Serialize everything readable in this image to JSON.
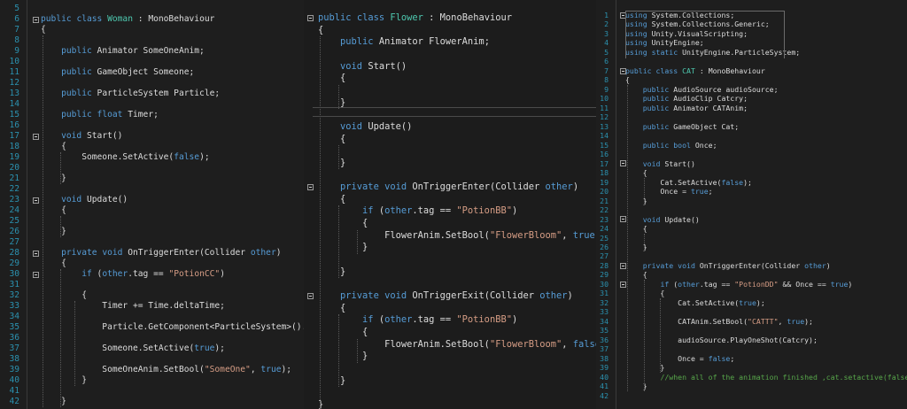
{
  "panels": [
    {
      "id": "woman",
      "line_numbers": [
        "5",
        "6",
        "7",
        "8",
        "9",
        "10",
        "11",
        "12",
        "13",
        "14",
        "15",
        "16",
        "17",
        "18",
        "19",
        "20",
        "21",
        "22",
        "23",
        "24",
        "25",
        "26",
        "27",
        "28",
        "29",
        "30",
        "31",
        "32",
        "33",
        "34",
        "35",
        "36",
        "37",
        "38",
        "39",
        "40",
        "41",
        "42"
      ],
      "lines": [
        [],
        [
          [
            "k",
            "public"
          ],
          [
            "pl",
            " "
          ],
          [
            "k",
            "class"
          ],
          [
            "pl",
            " "
          ],
          [
            "t",
            "Woman"
          ],
          [
            "pl",
            " : MonoBehaviour"
          ]
        ],
        [
          [
            "pl",
            "{"
          ]
        ],
        [],
        [
          [
            "pl",
            "    "
          ],
          [
            "k",
            "public"
          ],
          [
            "pl",
            " Animator SomeOneAnim;"
          ]
        ],
        [],
        [
          [
            "pl",
            "    "
          ],
          [
            "k",
            "public"
          ],
          [
            "pl",
            " GameObject Someone;"
          ]
        ],
        [],
        [
          [
            "pl",
            "    "
          ],
          [
            "k",
            "public"
          ],
          [
            "pl",
            " ParticleSystem Particle;"
          ]
        ],
        [],
        [
          [
            "pl",
            "    "
          ],
          [
            "k",
            "public"
          ],
          [
            "pl",
            " "
          ],
          [
            "k",
            "float"
          ],
          [
            "pl",
            " Timer;"
          ]
        ],
        [],
        [
          [
            "pl",
            "    "
          ],
          [
            "k",
            "void"
          ],
          [
            "pl",
            " Start()"
          ]
        ],
        [
          [
            "pl",
            "    {"
          ]
        ],
        [
          [
            "pl",
            "        Someone.SetActive("
          ],
          [
            "k",
            "false"
          ],
          [
            "pl",
            ");"
          ]
        ],
        [],
        [
          [
            "pl",
            "    }"
          ]
        ],
        [],
        [
          [
            "pl",
            "    "
          ],
          [
            "k",
            "void"
          ],
          [
            "pl",
            " Update()"
          ]
        ],
        [
          [
            "pl",
            "    {"
          ]
        ],
        [],
        [
          [
            "pl",
            "    }"
          ]
        ],
        [],
        [
          [
            "pl",
            "    "
          ],
          [
            "k",
            "private"
          ],
          [
            "pl",
            " "
          ],
          [
            "k",
            "void"
          ],
          [
            "pl",
            " OnTriggerEnter(Collider "
          ],
          [
            "k",
            "other"
          ],
          [
            "pl",
            ")"
          ]
        ],
        [
          [
            "pl",
            "    {"
          ]
        ],
        [
          [
            "pl",
            "        "
          ],
          [
            "k",
            "if"
          ],
          [
            "pl",
            " ("
          ],
          [
            "k",
            "other"
          ],
          [
            "pl",
            ".tag == "
          ],
          [
            "s",
            "\"PotionCC\""
          ],
          [
            "pl",
            ")"
          ]
        ],
        [],
        [
          [
            "pl",
            "        {"
          ]
        ],
        [
          [
            "pl",
            "            Timer += Time.deltaTime;"
          ]
        ],
        [],
        [
          [
            "pl",
            "            Particle.GetComponent<ParticleSystem>().Play();"
          ]
        ],
        [],
        [
          [
            "pl",
            "            Someone.SetActive("
          ],
          [
            "k",
            "true"
          ],
          [
            "pl",
            ");"
          ]
        ],
        [],
        [
          [
            "pl",
            "            SomeOneAnim.SetBool("
          ],
          [
            "s",
            "\"SomeOne\""
          ],
          [
            "pl",
            ", "
          ],
          [
            "k",
            "true"
          ],
          [
            "pl",
            ");"
          ]
        ],
        [
          [
            "pl",
            "        }"
          ]
        ],
        [],
        [
          [
            "pl",
            "    }"
          ]
        ]
      ]
    },
    {
      "id": "flower",
      "line_numbers": [],
      "lines": [
        [
          [
            "k",
            "public"
          ],
          [
            "pl",
            " "
          ],
          [
            "k",
            "class"
          ],
          [
            "pl",
            " "
          ],
          [
            "t",
            "Flower"
          ],
          [
            "pl",
            " : MonoBehaviour"
          ]
        ],
        [
          [
            "pl",
            "{"
          ]
        ],
        [
          [
            "pl",
            "    "
          ],
          [
            "k",
            "public"
          ],
          [
            "pl",
            " Animator FlowerAnim;"
          ]
        ],
        [],
        [
          [
            "pl",
            "    "
          ],
          [
            "k",
            "void"
          ],
          [
            "pl",
            " Start()"
          ]
        ],
        [
          [
            "pl",
            "    {"
          ]
        ],
        [],
        [
          [
            "pl",
            "    }"
          ]
        ],
        [],
        [
          [
            "pl",
            "    "
          ],
          [
            "k",
            "void"
          ],
          [
            "pl",
            " Update()"
          ]
        ],
        [
          [
            "pl",
            "    {"
          ]
        ],
        [],
        [
          [
            "pl",
            "    }"
          ]
        ],
        [],
        [
          [
            "pl",
            "    "
          ],
          [
            "k",
            "private"
          ],
          [
            "pl",
            " "
          ],
          [
            "k",
            "void"
          ],
          [
            "pl",
            " OnTriggerEnter(Collider "
          ],
          [
            "k",
            "other"
          ],
          [
            "pl",
            ")"
          ]
        ],
        [
          [
            "pl",
            "    {"
          ]
        ],
        [
          [
            "pl",
            "        "
          ],
          [
            "k",
            "if"
          ],
          [
            "pl",
            " ("
          ],
          [
            "k",
            "other"
          ],
          [
            "pl",
            ".tag == "
          ],
          [
            "s",
            "\"PotionBB\""
          ],
          [
            "pl",
            ")"
          ]
        ],
        [
          [
            "pl",
            "        {"
          ]
        ],
        [
          [
            "pl",
            "            FlowerAnim.SetBool("
          ],
          [
            "s",
            "\"FlowerBloom\""
          ],
          [
            "pl",
            ", "
          ],
          [
            "k",
            "true"
          ],
          [
            "pl",
            ");"
          ]
        ],
        [
          [
            "pl",
            "        }"
          ]
        ],
        [],
        [
          [
            "pl",
            "    }"
          ]
        ],
        [],
        [
          [
            "pl",
            "    "
          ],
          [
            "k",
            "private"
          ],
          [
            "pl",
            " "
          ],
          [
            "k",
            "void"
          ],
          [
            "pl",
            " OnTriggerExit(Collider "
          ],
          [
            "k",
            "other"
          ],
          [
            "pl",
            ")"
          ]
        ],
        [
          [
            "pl",
            "    {"
          ]
        ],
        [
          [
            "pl",
            "        "
          ],
          [
            "k",
            "if"
          ],
          [
            "pl",
            " ("
          ],
          [
            "k",
            "other"
          ],
          [
            "pl",
            ".tag == "
          ],
          [
            "s",
            "\"PotionBB\""
          ],
          [
            "pl",
            ")"
          ]
        ],
        [
          [
            "pl",
            "        {"
          ]
        ],
        [
          [
            "pl",
            "            FlowerAnim.SetBool("
          ],
          [
            "s",
            "\"FlowerBloom\""
          ],
          [
            "pl",
            ", "
          ],
          [
            "k",
            "false"
          ],
          [
            "pl",
            ");"
          ]
        ],
        [
          [
            "pl",
            "        }"
          ]
        ],
        [],
        [
          [
            "pl",
            "    }"
          ]
        ],
        [],
        [
          [
            "pl",
            "}"
          ]
        ]
      ]
    },
    {
      "id": "cat",
      "line_numbers": [
        "1",
        "2",
        "3",
        "4",
        "5",
        "6",
        "7",
        "8",
        "9",
        "10",
        "11",
        "12",
        "13",
        "14",
        "15",
        "16",
        "17",
        "18",
        "19",
        "20",
        "21",
        "22",
        "23",
        "24",
        "25",
        "26",
        "27",
        "28",
        "29",
        "30",
        "31",
        "32",
        "33",
        "34",
        "35",
        "36",
        "37",
        "38",
        "39",
        "40",
        "41",
        "42"
      ],
      "lines": [
        [
          [
            "k",
            "using"
          ],
          [
            "pl",
            " System.Collections;"
          ]
        ],
        [
          [
            "k",
            "using"
          ],
          [
            "pl",
            " System.Collections.Generic;"
          ]
        ],
        [
          [
            "k",
            "using"
          ],
          [
            "pl",
            " Unity.VisualScripting;"
          ]
        ],
        [
          [
            "k",
            "using"
          ],
          [
            "pl",
            " UnityEngine;"
          ]
        ],
        [
          [
            "k",
            "using"
          ],
          [
            "pl",
            " "
          ],
          [
            "k",
            "static"
          ],
          [
            "pl",
            " UnityEngine.ParticleSystem;"
          ]
        ],
        [],
        [
          [
            "k",
            "public"
          ],
          [
            "pl",
            " "
          ],
          [
            "k",
            "class"
          ],
          [
            "pl",
            " "
          ],
          [
            "t",
            "CAT"
          ],
          [
            "pl",
            " : MonoBehaviour"
          ]
        ],
        [
          [
            "pl",
            "{"
          ]
        ],
        [
          [
            "pl",
            "    "
          ],
          [
            "k",
            "public"
          ],
          [
            "pl",
            " AudioSource audioSource;"
          ]
        ],
        [
          [
            "pl",
            "    "
          ],
          [
            "k",
            "public"
          ],
          [
            "pl",
            " AudioClip Catcry;"
          ]
        ],
        [
          [
            "pl",
            "    "
          ],
          [
            "k",
            "public"
          ],
          [
            "pl",
            " Animator CATAnim;"
          ]
        ],
        [],
        [
          [
            "pl",
            "    "
          ],
          [
            "k",
            "public"
          ],
          [
            "pl",
            " GameObject Cat;"
          ]
        ],
        [],
        [
          [
            "pl",
            "    "
          ],
          [
            "k",
            "public"
          ],
          [
            "pl",
            " "
          ],
          [
            "k",
            "bool"
          ],
          [
            "pl",
            " Once;"
          ]
        ],
        [],
        [
          [
            "pl",
            "    "
          ],
          [
            "k",
            "void"
          ],
          [
            "pl",
            " Start()"
          ]
        ],
        [
          [
            "pl",
            "    {"
          ]
        ],
        [
          [
            "pl",
            "        Cat.SetActive("
          ],
          [
            "k",
            "false"
          ],
          [
            "pl",
            ");"
          ]
        ],
        [
          [
            "pl",
            "        Once = "
          ],
          [
            "k",
            "true"
          ],
          [
            "pl",
            ";"
          ]
        ],
        [
          [
            "pl",
            "    }"
          ]
        ],
        [],
        [
          [
            "pl",
            "    "
          ],
          [
            "k",
            "void"
          ],
          [
            "pl",
            " Update()"
          ]
        ],
        [
          [
            "pl",
            "    {"
          ]
        ],
        [],
        [
          [
            "pl",
            "    }"
          ]
        ],
        [],
        [
          [
            "pl",
            "    "
          ],
          [
            "k",
            "private"
          ],
          [
            "pl",
            " "
          ],
          [
            "k",
            "void"
          ],
          [
            "pl",
            " OnTriggerEnter(Collider "
          ],
          [
            "k",
            "other"
          ],
          [
            "pl",
            ")"
          ]
        ],
        [
          [
            "pl",
            "    {"
          ]
        ],
        [
          [
            "pl",
            "        "
          ],
          [
            "k",
            "if"
          ],
          [
            "pl",
            " ("
          ],
          [
            "k",
            "other"
          ],
          [
            "pl",
            ".tag == "
          ],
          [
            "s",
            "\"PotionDD\""
          ],
          [
            "pl",
            " && Once == "
          ],
          [
            "k",
            "true"
          ],
          [
            "pl",
            ")"
          ]
        ],
        [
          [
            "pl",
            "        {"
          ]
        ],
        [
          [
            "pl",
            "            Cat.SetActive("
          ],
          [
            "k",
            "true"
          ],
          [
            "pl",
            ");"
          ]
        ],
        [],
        [
          [
            "pl",
            "            CATAnim.SetBool("
          ],
          [
            "s",
            "\"CATTT\""
          ],
          [
            "pl",
            ", "
          ],
          [
            "k",
            "true"
          ],
          [
            "pl",
            ");"
          ]
        ],
        [],
        [
          [
            "pl",
            "            audioSource.PlayOneShot(Catcry);"
          ]
        ],
        [],
        [
          [
            "pl",
            "            Once = "
          ],
          [
            "k",
            "false"
          ],
          [
            "pl",
            ";"
          ]
        ],
        [
          [
            "pl",
            "        }"
          ]
        ],
        [
          [
            "pl",
            "        "
          ],
          [
            "c",
            "//when all of the animation finished ,cat.setactive(false)"
          ]
        ],
        [
          [
            "pl",
            "    }"
          ]
        ],
        []
      ]
    }
  ]
}
